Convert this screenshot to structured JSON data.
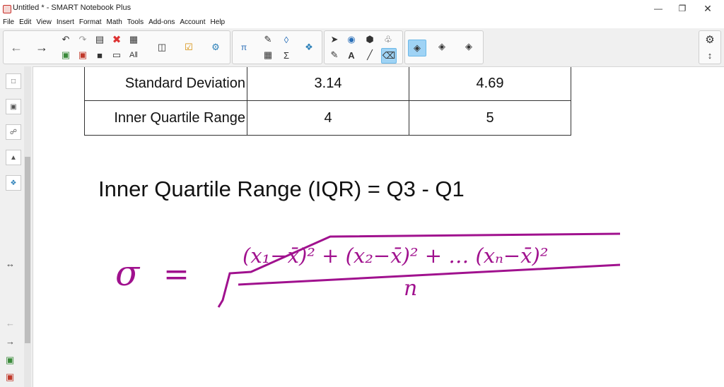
{
  "window": {
    "title": "Untitled * - SMART Notebook Plus"
  },
  "menu": [
    "File",
    "Edit",
    "View",
    "Insert",
    "Format",
    "Math",
    "Tools",
    "Add-ons",
    "Account",
    "Help"
  ],
  "colors": {
    "ink": "#a0118e",
    "toolbar_bg": "#f0f0f0",
    "active_tool": "#9fd3f5"
  },
  "table": {
    "rows": [
      {
        "label": "Standard Deviation",
        "v1": "3.14",
        "v2": "4.69"
      },
      {
        "label": "Inner Quartile Range",
        "v1": "4",
        "v2": "5"
      }
    ]
  },
  "formula_text": "Inner Quartile Range (IQR) = Q3 - Q1",
  "handwriting": {
    "sigma": "σ",
    "equals": "=",
    "numerator": "(x₁−x̄)² + (x₂−x̄)² + … (xₙ−x̄)²",
    "denominator": "n"
  }
}
